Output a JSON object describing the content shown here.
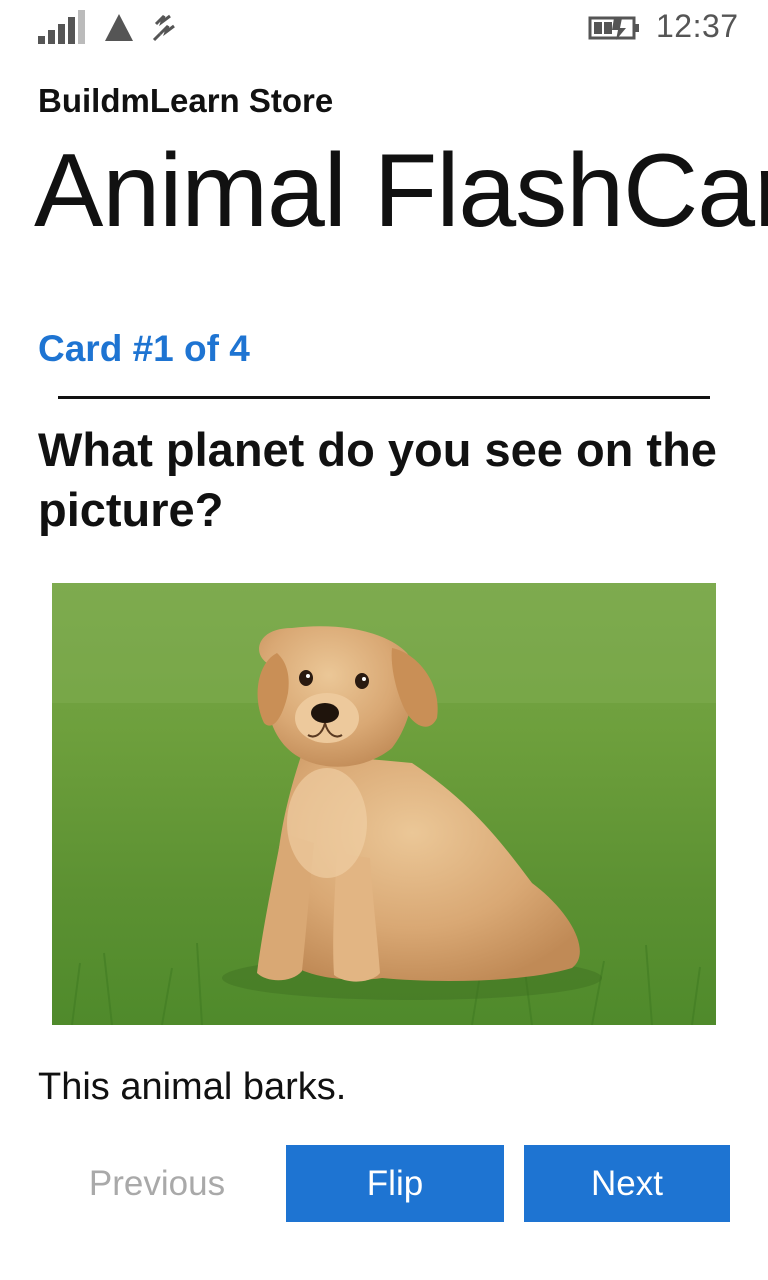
{
  "status_bar": {
    "time": "12:37",
    "icons": [
      "signal-strength-icon",
      "network-triangle-icon",
      "data-sync-icon",
      "battery-charging-icon"
    ]
  },
  "header": {
    "app_name": "BuildmLearn Store",
    "page_title": "Animal FlashCards"
  },
  "card": {
    "counter": "Card #1 of 4",
    "question": "What planet do you see on the picture?",
    "image_subject": "puppy-photo",
    "answer": "This animal barks."
  },
  "buttons": {
    "previous": "Previous",
    "flip": "Flip",
    "next": "Next"
  },
  "colors": {
    "accent": "#1e74d2",
    "disabled_text": "#a9a9a9",
    "background": "#ffffff"
  }
}
